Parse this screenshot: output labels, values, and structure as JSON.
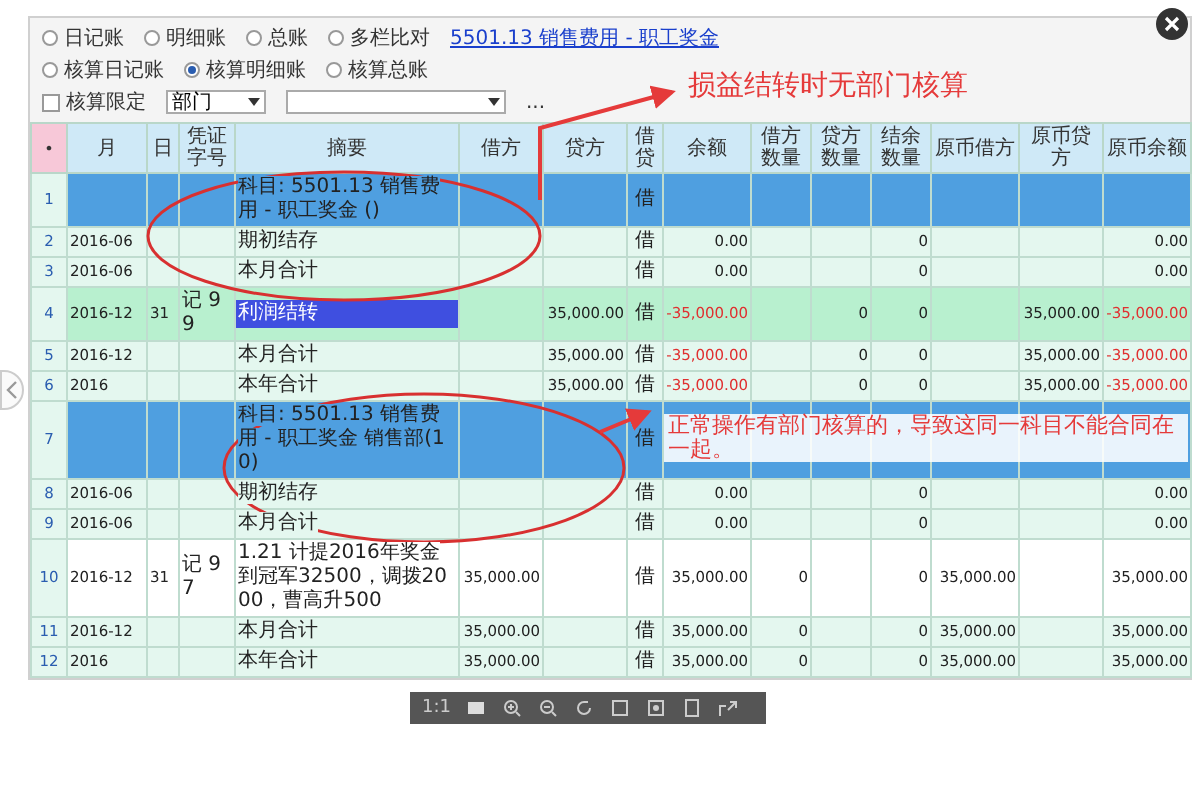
{
  "radio_rows": [
    [
      {
        "label": "日记账",
        "selected": false
      },
      {
        "label": "明细账",
        "selected": false
      },
      {
        "label": "总账",
        "selected": false
      },
      {
        "label": "多栏比对",
        "selected": false
      }
    ],
    [
      {
        "label": "核算日记账",
        "selected": false
      },
      {
        "label": "核算明细账",
        "selected": true
      },
      {
        "label": "核算总账",
        "selected": false
      }
    ]
  ],
  "account_link": "5501.13 销售费用 - 职工奖金",
  "filter": {
    "checkbox": {
      "label": "核算限定",
      "checked": false
    },
    "dimension": "部门",
    "more": "..."
  },
  "table": {
    "columns": [
      "•",
      "月",
      "日",
      "凭证字号",
      "摘要",
      "借方",
      "贷方",
      "借贷",
      "余额",
      "借方数量",
      "贷方数量",
      "结余数量",
      "原币借方",
      "原币贷方",
      "原币余额"
    ],
    "rows": [
      {
        "kind": "subject",
        "selected": false,
        "cells": [
          "1",
          "",
          "",
          "",
          "科目: 5501.13 销售费用 - 职工奖金 ()",
          "",
          "",
          "借",
          "",
          "",
          "",
          "",
          "",
          "",
          ""
        ]
      },
      {
        "kind": "summary",
        "selected": false,
        "cells": [
          "2",
          "2016-06",
          "",
          "",
          "期初结存",
          "",
          "",
          "借",
          "0.00",
          "",
          "",
          "0",
          "",
          "",
          "0.00"
        ]
      },
      {
        "kind": "summary",
        "selected": false,
        "cells": [
          "3",
          "2016-06",
          "",
          "",
          "本月合计",
          "",
          "",
          "借",
          "0.00",
          "",
          "",
          "0",
          "",
          "",
          "0.00"
        ]
      },
      {
        "kind": "entry",
        "selected": true,
        "cells": [
          "4",
          "2016-12",
          "31",
          "记 99",
          "利润结转",
          "",
          "35,000.00",
          "借",
          {
            "text": "-35,000.00",
            "negative": true
          },
          "",
          "0",
          "0",
          "",
          "35,000.00",
          {
            "text": "-35,000.00",
            "negative": true
          }
        ]
      },
      {
        "kind": "summary",
        "selected": false,
        "cells": [
          "5",
          "2016-12",
          "",
          "",
          "本月合计",
          "",
          "35,000.00",
          "借",
          {
            "text": "-35,000.00",
            "negative": true
          },
          "",
          "0",
          "0",
          "",
          "35,000.00",
          {
            "text": "-35,000.00",
            "negative": true
          }
        ]
      },
      {
        "kind": "summary",
        "selected": false,
        "cells": [
          "6",
          "2016",
          "",
          "",
          "本年合计",
          "",
          "35,000.00",
          "借",
          {
            "text": "-35,000.00",
            "negative": true
          },
          "",
          "0",
          "0",
          "",
          "35,000.00",
          {
            "text": "-35,000.00",
            "negative": true
          }
        ]
      },
      {
        "kind": "subject",
        "selected": false,
        "cells": [
          "7",
          "",
          "",
          "",
          "科目: 5501.13 销售费用 - 职工奖金 销售部(10)",
          "",
          "",
          "借",
          "",
          "",
          "",
          "",
          "",
          "",
          ""
        ]
      },
      {
        "kind": "summary",
        "selected": false,
        "cells": [
          "8",
          "2016-06",
          "",
          "",
          "期初结存",
          "",
          "",
          "借",
          "0.00",
          "",
          "",
          "0",
          "",
          "",
          "0.00"
        ]
      },
      {
        "kind": "summary",
        "selected": false,
        "cells": [
          "9",
          "2016-06",
          "",
          "",
          "本月合计",
          "",
          "",
          "借",
          "0.00",
          "",
          "",
          "0",
          "",
          "",
          "0.00"
        ]
      },
      {
        "kind": "entry",
        "selected": false,
        "cells": [
          "10",
          "2016-12",
          "31",
          "记 97",
          "1.21 计提2016年奖金到冠军32500，调拨2000，曹高升500",
          "35,000.00",
          "",
          "借",
          "35,000.00",
          "0",
          "",
          "0",
          "35,000.00",
          "",
          "35,000.00"
        ]
      },
      {
        "kind": "summary",
        "selected": false,
        "cells": [
          "11",
          "2016-12",
          "",
          "",
          "本月合计",
          "35,000.00",
          "",
          "借",
          "35,000.00",
          "0",
          "",
          "0",
          "35,000.00",
          "",
          "35,000.00"
        ]
      },
      {
        "kind": "summary",
        "selected": false,
        "cells": [
          "12",
          "2016",
          "",
          "",
          "本年合计",
          "35,000.00",
          "",
          "借",
          "35,000.00",
          "0",
          "",
          "0",
          "35,000.00",
          "",
          "35,000.00"
        ]
      }
    ]
  },
  "annotations": [
    {
      "text": "损益结转时无部门核算"
    },
    {
      "text": "正常操作有部门核算的，导致这同一科目不能合同在一起。"
    }
  ],
  "viewer": {
    "zoom_label": "1:1"
  }
}
